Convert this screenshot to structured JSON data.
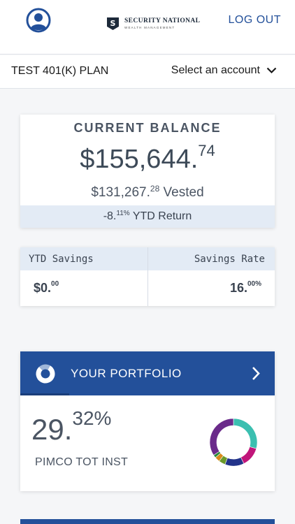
{
  "header": {
    "logo_name": "SECURITY NATIONAL",
    "logo_sub": "WEALTH MANAGEMENT",
    "logo_letter": "S",
    "logout_label": "LOG OUT"
  },
  "plan": {
    "name": "TEST 401(K) PLAN",
    "account_select_label": "Select an account"
  },
  "balance": {
    "title": "CURRENT BALANCE",
    "amount_main": "$155,644.",
    "amount_cents": "74",
    "vested_main": "$131,267.",
    "vested_cents": "28",
    "vested_label": " Vested",
    "ytd_main": "-8.",
    "ytd_cents": "11%",
    "ytd_label": " YTD Return"
  },
  "savings": {
    "ytd_label": "YTD Savings",
    "ytd_main": "$0.",
    "ytd_cents": "00",
    "rate_label": "Savings Rate",
    "rate_main": "16.",
    "rate_cents": "00%"
  },
  "portfolio": {
    "title": "YOUR PORTFOLIO",
    "top_pct_main": "29.",
    "top_pct_cents": "32%",
    "top_fund": "PIMCO TOT INST",
    "allocation": [
      {
        "value": 29.32,
        "color": "#3bbfb0"
      },
      {
        "value": 13.5,
        "color": "#c0167a"
      },
      {
        "value": 13.0,
        "color": "#22338a"
      },
      {
        "value": 4.5,
        "color": "#6b9a2a"
      },
      {
        "value": 3.5,
        "color": "#d98a1a"
      },
      {
        "value": 2.0,
        "color": "#2a8a3a"
      },
      {
        "value": 34.18,
        "color": "#6a2a8a"
      }
    ]
  },
  "colors": {
    "brand_blue": "#23509a",
    "light_blue": "#e3ebf5"
  }
}
